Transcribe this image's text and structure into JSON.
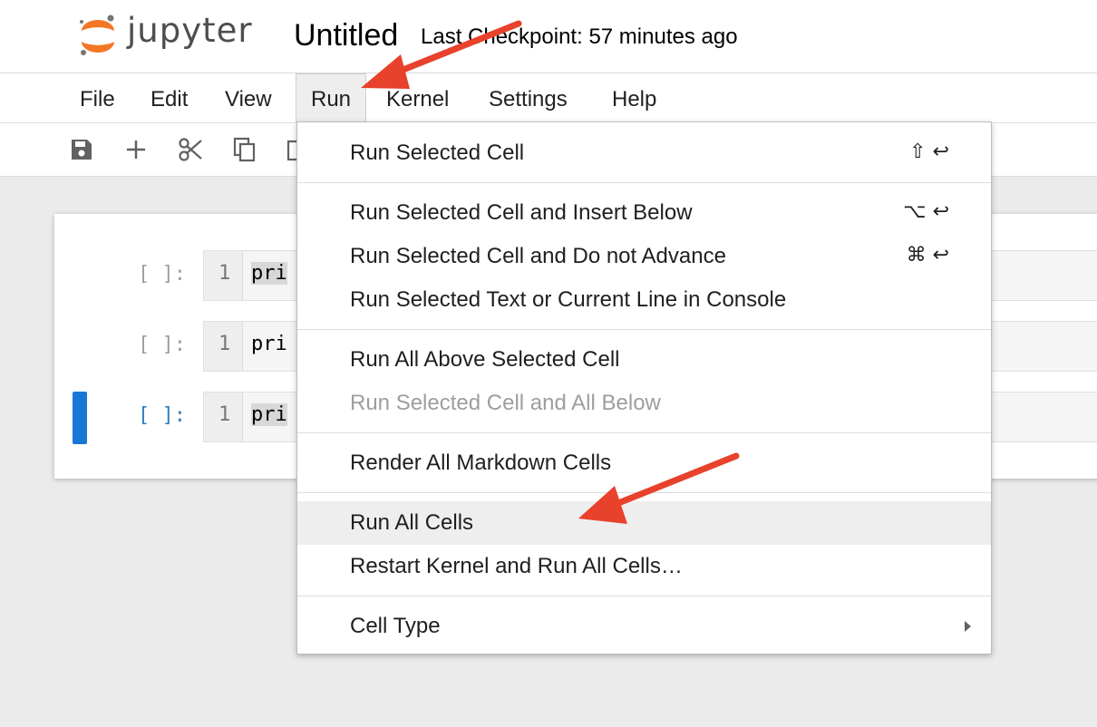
{
  "header": {
    "logo_text": "jupyter",
    "notebook_title": "Untitled",
    "checkpoint": "Last Checkpoint: 57 minutes ago"
  },
  "menubar": {
    "items": [
      {
        "label": "File"
      },
      {
        "label": "Edit"
      },
      {
        "label": "View"
      },
      {
        "label": "Run"
      },
      {
        "label": "Kernel"
      },
      {
        "label": "Settings"
      },
      {
        "label": "Help"
      }
    ],
    "active": "Run"
  },
  "toolbar": {
    "icons": [
      "save-icon",
      "add-icon",
      "cut-icon",
      "copy-icon",
      "paste-icon"
    ]
  },
  "cells": [
    {
      "prompt": "[ ]:",
      "line": "1",
      "code": "pri",
      "active": false
    },
    {
      "prompt": "[ ]:",
      "line": "1",
      "code": "pri",
      "active": false
    },
    {
      "prompt": "[ ]:",
      "line": "1",
      "code": "pri",
      "active": true
    }
  ],
  "run_menu": {
    "items": [
      {
        "label": "Run Selected Cell",
        "shortcut": "⇧ ↩"
      },
      {
        "label": "Run Selected Cell and Insert Below",
        "shortcut": "⌥ ↩"
      },
      {
        "label": "Run Selected Cell and Do not Advance",
        "shortcut": "⌘ ↩"
      },
      {
        "label": "Run Selected Text or Current Line in Console",
        "shortcut": ""
      },
      {
        "label": "Run All Above Selected Cell",
        "shortcut": ""
      },
      {
        "label": "Run Selected Cell and All Below",
        "shortcut": "",
        "disabled": true
      },
      {
        "label": "Render All Markdown Cells",
        "shortcut": ""
      },
      {
        "label": "Run All Cells",
        "shortcut": "",
        "highlighted": true
      },
      {
        "label": "Restart Kernel and Run All Cells…",
        "shortcut": ""
      },
      {
        "label": "Cell Type",
        "shortcut": "",
        "submenu": true
      }
    ]
  },
  "colors": {
    "jupyter_orange": "#f37726",
    "annotation_arrow": "#e8412c",
    "active_cell": "#1976d2"
  }
}
